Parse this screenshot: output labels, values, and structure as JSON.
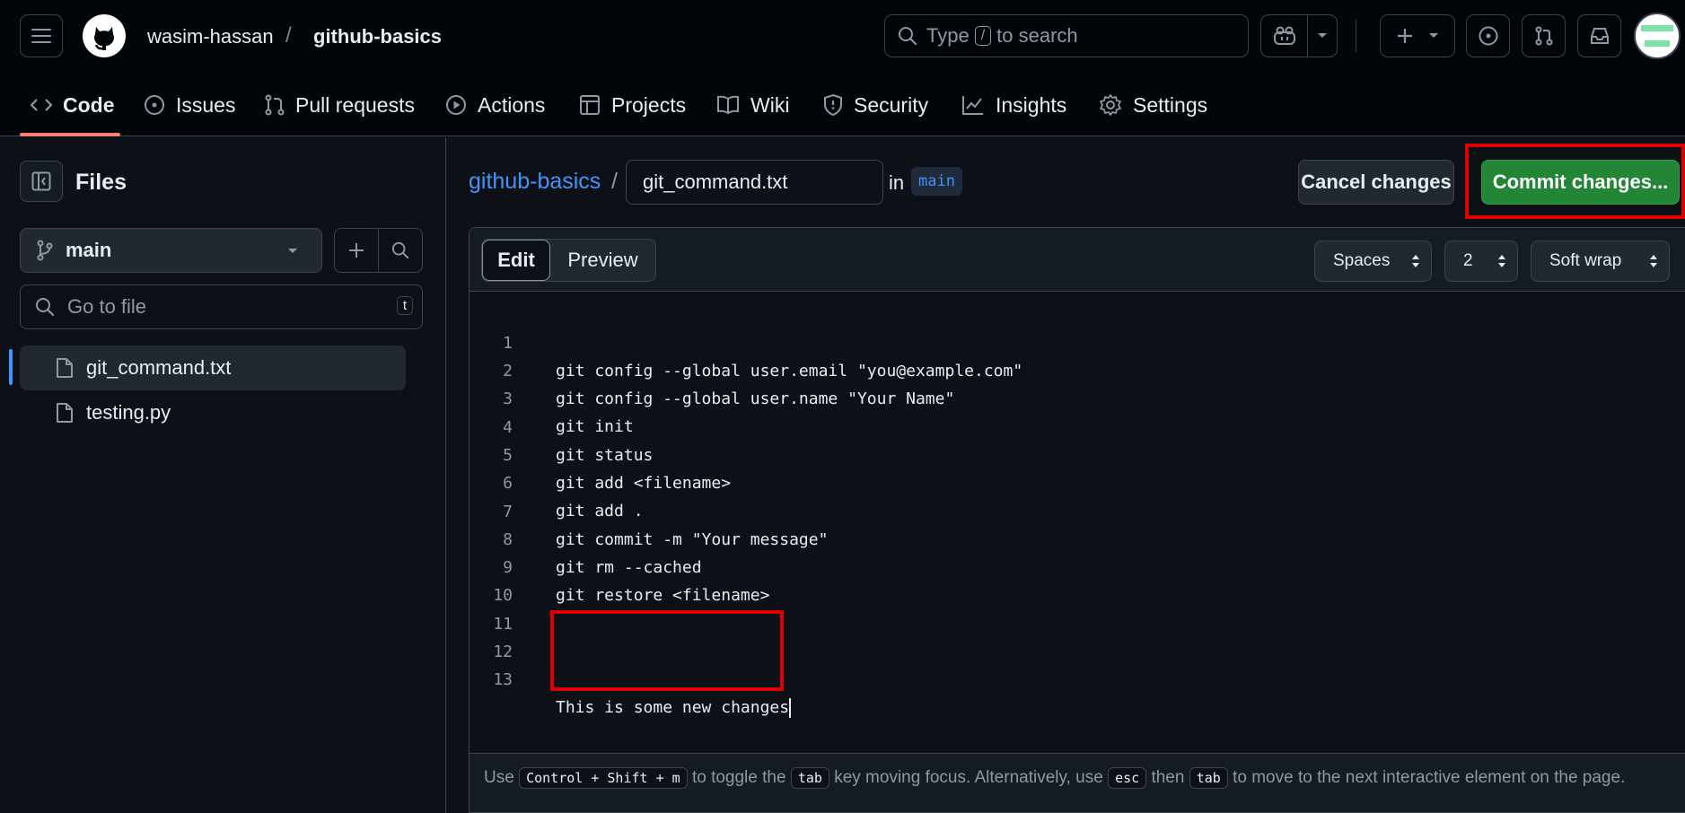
{
  "header": {
    "owner": "wasim-hassan",
    "separator": "/",
    "repo": "github-basics",
    "search_prefix": "Type",
    "search_key": "/",
    "search_suffix": "to search"
  },
  "repo_nav": {
    "tabs": [
      {
        "label": "Code",
        "icon": "code-icon",
        "active": true
      },
      {
        "label": "Issues",
        "icon": "issue-opened-icon"
      },
      {
        "label": "Pull requests",
        "icon": "git-pull-request-icon"
      },
      {
        "label": "Actions",
        "icon": "play-icon"
      },
      {
        "label": "Projects",
        "icon": "table-icon"
      },
      {
        "label": "Wiki",
        "icon": "book-icon"
      },
      {
        "label": "Security",
        "icon": "shield-icon"
      },
      {
        "label": "Insights",
        "icon": "graph-icon"
      },
      {
        "label": "Settings",
        "icon": "gear-icon"
      }
    ]
  },
  "sidebar": {
    "title": "Files",
    "branch": "main",
    "go_to_file_placeholder": "Go to file",
    "go_to_file_key": "t",
    "files": [
      {
        "name": "git_command.txt",
        "active": true
      },
      {
        "name": "testing.py",
        "active": false
      }
    ]
  },
  "editor": {
    "path_root": "github-basics",
    "path_sep": "/",
    "filename": "git_command.txt",
    "in_label": "in",
    "branch": "main",
    "cancel_label": "Cancel changes",
    "commit_label": "Commit changes...",
    "tab_edit": "Edit",
    "tab_preview": "Preview",
    "indent_mode": "Spaces",
    "indent_size": "2",
    "wrap_mode": "Soft wrap",
    "lines": [
      {
        "n": "1",
        "text": "git config --global user.email \"you@example.com\""
      },
      {
        "n": "2",
        "text": "git config --global user.name \"Your Name\""
      },
      {
        "n": "3",
        "text": "git init"
      },
      {
        "n": "4",
        "text": "git status"
      },
      {
        "n": "5",
        "text": "git add <filename>"
      },
      {
        "n": "6",
        "text": "git add ."
      },
      {
        "n": "7",
        "text": "git commit -m \"Your message\""
      },
      {
        "n": "8",
        "text": "git rm --cached"
      },
      {
        "n": "9",
        "text": "git restore <filename>"
      },
      {
        "n": "10",
        "text": ""
      },
      {
        "n": "11",
        "text": ""
      },
      {
        "n": "12",
        "text": ""
      },
      {
        "n": "13",
        "text": "This is some new changes"
      }
    ],
    "help": {
      "use": "Use",
      "shortcut": "Control + Shift + m",
      "toggle_the": "to toggle the",
      "tab_key": "tab",
      "key_moving": "key moving focus. Alternatively, use",
      "esc_key": "esc",
      "then": "then",
      "tab_key2": "tab",
      "rest": "to move to the next interactive element on the page."
    }
  },
  "colors": {
    "background": "#0d1117",
    "accent_blue": "#4493f8",
    "commit_green": "#238636",
    "tab_underline": "#f78166",
    "annotation_red": "#e00000"
  }
}
